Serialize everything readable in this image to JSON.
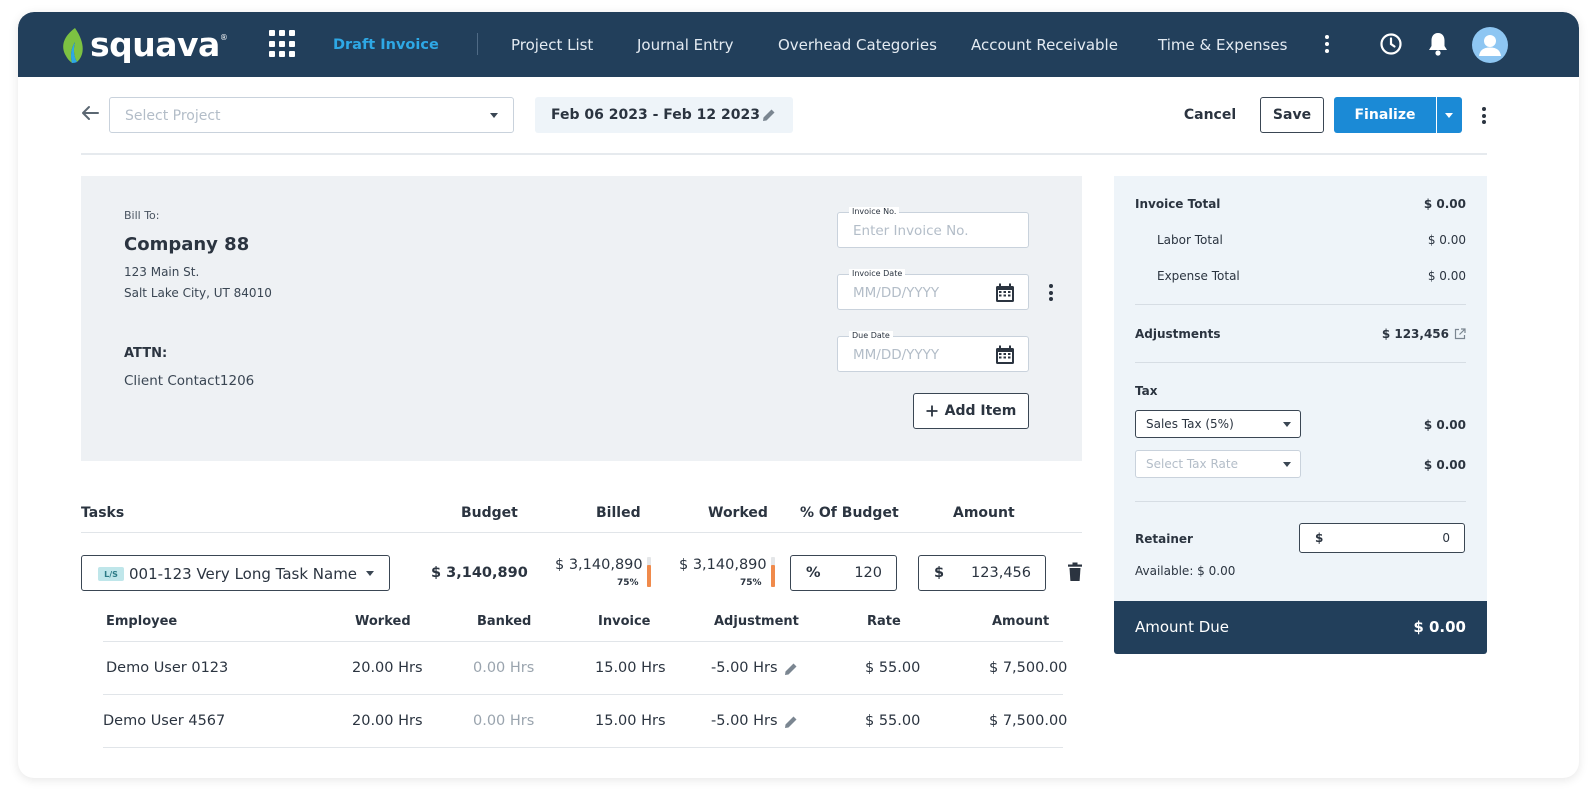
{
  "app": {
    "brand": "squava",
    "brand_mark": "®"
  },
  "nav": {
    "items": [
      {
        "label": "Draft Invoice",
        "active": true
      },
      {
        "label": "Project List"
      },
      {
        "label": "Journal Entry"
      },
      {
        "label": "Overhead Categories"
      },
      {
        "label": "Account Receivable"
      },
      {
        "label": "Time & Expenses"
      }
    ],
    "icons": [
      "apps-grid-icon",
      "more-vertical-icon",
      "clock-icon",
      "bell-icon",
      "user-avatar-icon"
    ]
  },
  "toolbar": {
    "project_placeholder": "Select Project",
    "date_range": "Feb 06 2023 - Feb 12 2023",
    "cancel": "Cancel",
    "save": "Save",
    "finalize": "Finalize"
  },
  "bill": {
    "label": "Bill To:",
    "company": "Company 88",
    "address_line1": "123 Main St.",
    "address_line2": "Salt Lake City, UT 84010",
    "attn_label": "ATTN:",
    "contact": "Client Contact1206",
    "invoice_no_label": "Invoice No.",
    "invoice_no_placeholder": "Enter Invoice No.",
    "invoice_date_label": "Invoice Date",
    "invoice_date_placeholder": "MM/DD/YYYY",
    "due_date_label": "Due  Date",
    "due_date_placeholder": "MM/DD/YYYY",
    "add_item": "Add Item"
  },
  "tasks": {
    "headers": [
      "Tasks",
      "Budget",
      "Billed",
      "Worked",
      "% Of Budget",
      "Amount"
    ],
    "row": {
      "badge": "L/S",
      "name": "001-123 Very Long Task Name",
      "budget": "$ 3,140,890",
      "billed": "$ 3,140,890",
      "billed_pct": "75%",
      "billed_fraction": 0.75,
      "worked": "$ 3,140,890",
      "worked_pct": "75%",
      "worked_fraction": 0.75,
      "pct_prefix": "%",
      "pct_value": "120",
      "amount_prefix": "$",
      "amount_value": "123,456"
    },
    "employee_headers": [
      "Employee",
      "Worked",
      "Banked",
      "Invoice",
      "Adjustment",
      "Rate",
      "Amount"
    ],
    "employees": [
      {
        "name": "Demo User 0123",
        "worked": "20.00 Hrs",
        "banked": "0.00 Hrs",
        "invoice": "15.00 Hrs",
        "adjustment": "-5.00 Hrs",
        "rate": "$ 55.00",
        "amount": "$ 7,500.00"
      },
      {
        "name": "Demo User 4567",
        "worked": "20.00 Hrs",
        "banked": "0.00 Hrs",
        "invoice": "15.00 Hrs",
        "adjustment": "-5.00 Hrs",
        "rate": "$ 55.00",
        "amount": "$ 7,500.00"
      }
    ]
  },
  "summary": {
    "invoice_total_label": "Invoice Total",
    "invoice_total": "$ 0.00",
    "labor_total_label": "Labor Total",
    "labor_total": "$ 0.00",
    "expense_total_label": "Expense Total",
    "expense_total": "$ 0.00",
    "adjustments_label": "Adjustments",
    "adjustments": "$ 123,456",
    "tax_label": "Tax",
    "tax_select": "Sales Tax (5%)",
    "tax_value": "$ 0.00",
    "tax_rate_placeholder": "Select Tax Rate",
    "tax_rate_value": "$ 0.00",
    "retainer_label": "Retainer",
    "retainer_prefix": "$",
    "retainer_value": "0",
    "available": "Available: $ 0.00",
    "amount_due_label": "Amount Due",
    "amount_due": "$ 0.00"
  },
  "colors": {
    "topbar": "#223f5b",
    "accent": "#1b8ad6",
    "active_nav": "#2ea8e5",
    "budget_bar": "#f08a4b",
    "panel": "#eef1f4",
    "summary_panel": "#eef4f9"
  }
}
